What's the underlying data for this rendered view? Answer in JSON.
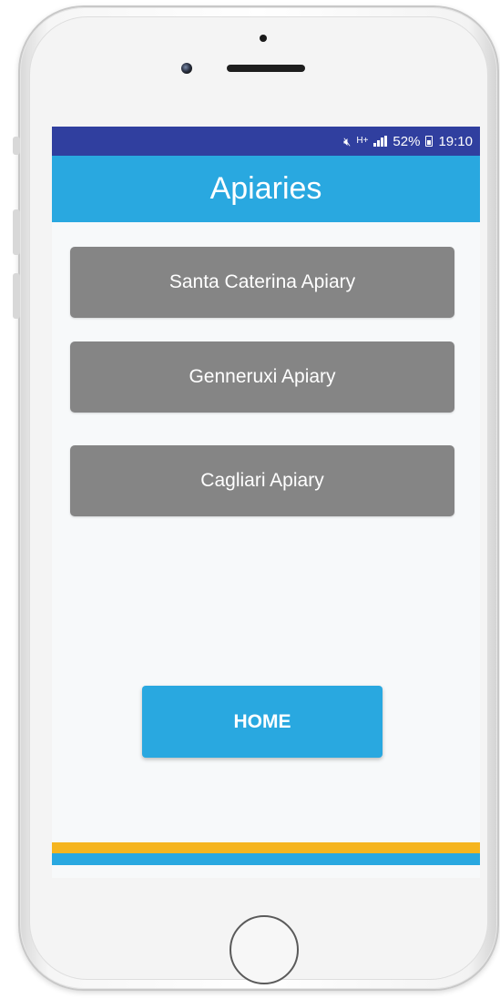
{
  "status_bar": {
    "battery": "52%",
    "time": "19:10",
    "network": "H+"
  },
  "app_bar": {
    "title": "Apiaries"
  },
  "apiaries": [
    {
      "label": "Santa Caterina Apiary"
    },
    {
      "label": "Genneruxi Apiary"
    },
    {
      "label": "Cagliari Apiary"
    }
  ],
  "home_button": {
    "label": "HOME"
  },
  "colors": {
    "status_bar": "#303f9f",
    "primary": "#29a8e0",
    "apiary_button": "#858585",
    "accent_stripe": "#f5b51e"
  },
  "icons": {
    "mute": "mute-icon",
    "network": "network-type-icon",
    "signal": "signal-icon",
    "battery": "battery-icon"
  }
}
